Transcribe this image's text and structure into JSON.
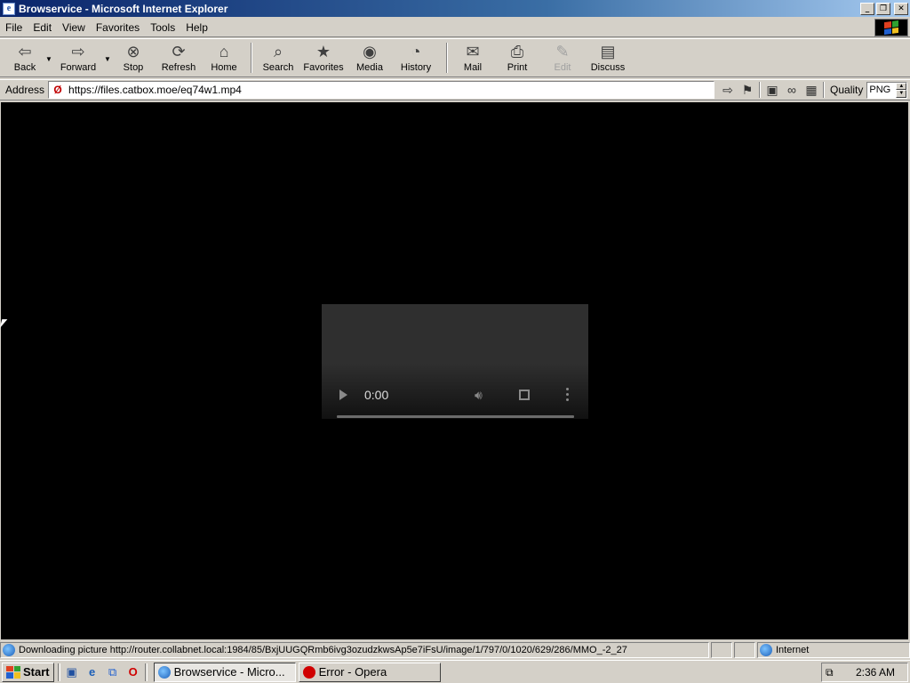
{
  "window": {
    "title": "Browservice - Microsoft Internet Explorer",
    "buttons": [
      "minimize",
      "restore",
      "close"
    ]
  },
  "menu": [
    "File",
    "Edit",
    "View",
    "Favorites",
    "Tools",
    "Help"
  ],
  "toolbar": {
    "back": "Back",
    "forward": "Forward",
    "stop": "Stop",
    "refresh": "Refresh",
    "home": "Home",
    "search": "Search",
    "favorites": "Favorites",
    "media": "Media",
    "history": "History",
    "mail": "Mail",
    "print": "Print",
    "edit": "Edit",
    "discuss": "Discuss"
  },
  "address": {
    "label": "Address",
    "url": "https://files.catbox.moe/eq74w1.mp4",
    "quality_label": "Quality",
    "quality_value": "PNG"
  },
  "video": {
    "time": "0:00",
    "progress": 0
  },
  "status": {
    "text": "Downloading picture http://router.collabnet.local:1984/85/BxjUUGQRmb6ivg3ozudzkwsAp5e7iFsU/image/1/797/0/1020/629/286/MMO_-2_27",
    "zone": "Internet"
  },
  "taskbar": {
    "start": "Start",
    "tasks": [
      {
        "label": "Browservice - Micro...",
        "active": true
      },
      {
        "label": "Error - Opera",
        "active": false
      }
    ],
    "clock": "2:36 AM"
  },
  "colors": {
    "titlebar_start": "#0a246a",
    "chrome": "#d4d0c8",
    "content_bg": "#000000"
  }
}
